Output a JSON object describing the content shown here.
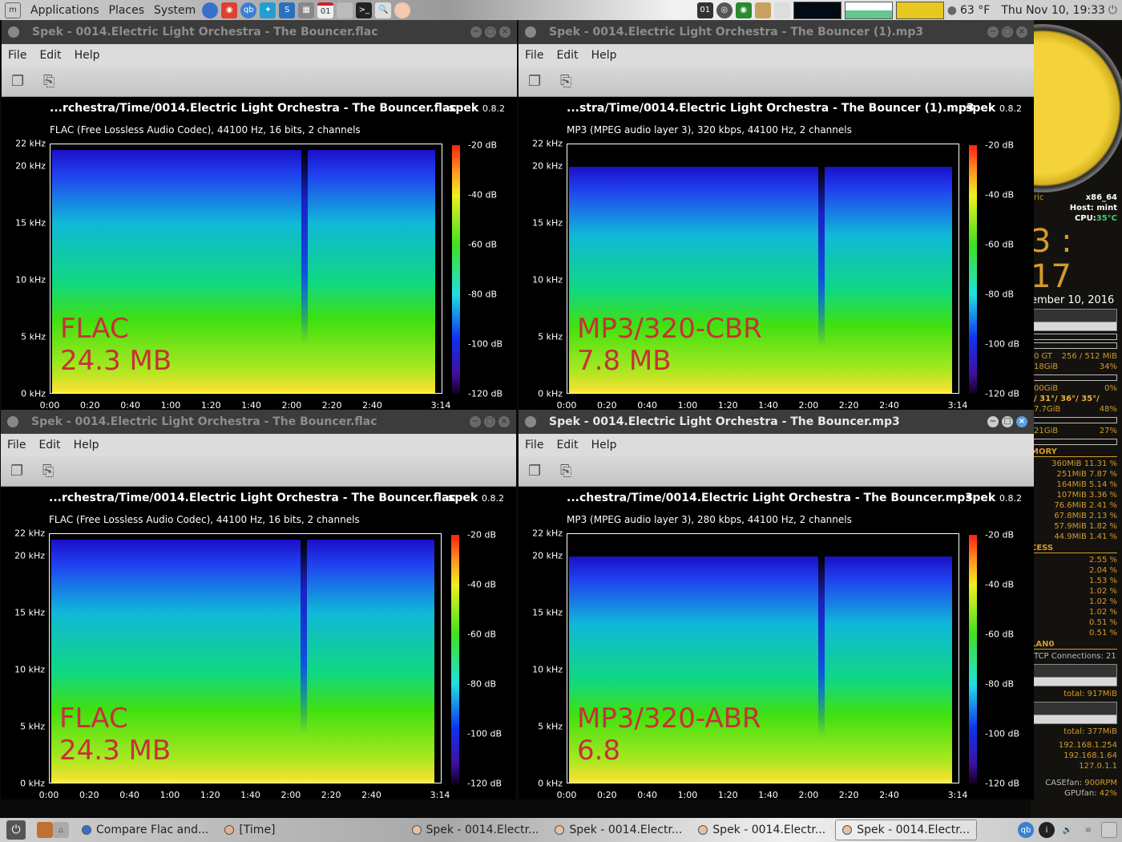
{
  "top_panel": {
    "menu": [
      "Applications",
      "Places",
      "System"
    ],
    "launchers": [
      "globe-icon",
      "chrome-icon",
      "qbittorrent-icon",
      "kodi-icon",
      "steam-icon",
      "calculator-icon",
      "calendar-icon",
      "gimp-icon",
      "terminal-icon",
      "search-icon",
      "pidgin-icon"
    ],
    "calendar_day": "01",
    "weather": "63 °F",
    "datetime": "Thu Nov 10, 19:33"
  },
  "windows": [
    {
      "title": "Spek - 0014.Electric Light Orchestra - The Bouncer.flac",
      "active": false,
      "menu": [
        "File",
        "Edit",
        "Help"
      ],
      "file_path": "...rchestra/Time/0014.Electric Light Orchestra - The Bouncer.flac",
      "app_name": "spek",
      "app_version": "0.8.2",
      "codec_info": "FLAC (Free Lossless Audio Codec), 44100 Hz, 16 bits, 2 channels",
      "overlay_label": [
        "FLAC",
        "24.3 MB"
      ],
      "cutoff_khz": 21.5
    },
    {
      "title": "Spek - 0014.Electric Light Orchestra - The Bouncer (1).mp3",
      "active": false,
      "menu": [
        "File",
        "Edit",
        "Help"
      ],
      "file_path": "...stra/Time/0014.Electric Light Orchestra - The Bouncer (1).mp3",
      "app_name": "spek",
      "app_version": "0.8.2",
      "codec_info": "MP3 (MPEG audio layer 3), 320 kbps, 44100 Hz, 2 channels",
      "overlay_label": [
        "MP3/320-CBR",
        "7.8 MB"
      ],
      "cutoff_khz": 20
    },
    {
      "title": "Spek - 0014.Electric Light Orchestra - The Bouncer.flac",
      "active": false,
      "menu": [
        "File",
        "Edit",
        "Help"
      ],
      "file_path": "...rchestra/Time/0014.Electric Light Orchestra - The Bouncer.flac",
      "app_name": "spek",
      "app_version": "0.8.2",
      "codec_info": "FLAC (Free Lossless Audio Codec), 44100 Hz, 16 bits, 2 channels",
      "overlay_label": [
        "FLAC",
        "24.3 MB"
      ],
      "cutoff_khz": 21.5
    },
    {
      "title": "Spek - 0014.Electric Light Orchestra - The Bouncer.mp3",
      "active": true,
      "menu": [
        "File",
        "Edit",
        "Help"
      ],
      "file_path": "...chestra/Time/0014.Electric Light Orchestra - The Bouncer.mp3",
      "app_name": "spek",
      "app_version": "0.8.2",
      "codec_info": "MP3 (MPEG audio layer 3), 280 kbps, 44100 Hz, 2 channels",
      "overlay_label": [
        "MP3/320-ABR",
        "6.8"
      ],
      "cutoff_khz": 20
    }
  ],
  "spectrogram_axes": {
    "y_ticks": [
      "22 kHz",
      "20 kHz",
      "15 kHz",
      "10 kHz",
      "5 kHz",
      "0 kHz"
    ],
    "y_values_khz": [
      22,
      20,
      15,
      10,
      5,
      0
    ],
    "x_ticks": [
      "0:00",
      "0:20",
      "0:40",
      "1:00",
      "1:20",
      "1:40",
      "2:00",
      "2:20",
      "2:40",
      "3:14"
    ],
    "x_values_s": [
      0,
      20,
      40,
      60,
      80,
      100,
      120,
      140,
      160,
      194
    ],
    "db_ticks": [
      "-20 dB",
      "-40 dB",
      "-60 dB",
      "-80 dB",
      "-100 dB",
      "-120 dB"
    ],
    "db_values": [
      -20,
      -40,
      -60,
      -80,
      -100,
      -120
    ]
  },
  "conky": {
    "arch": "x86_64",
    "host": "Host: mint",
    "cpu_label": "CPU:",
    "cpu_temp": "35°C",
    "time": "3 : 17",
    "date": "ember 10, 2016",
    "gpu": [
      "0 GT",
      "256 / 512 MiB"
    ],
    "disks": [
      [
        "18GiB",
        "34%"
      ],
      [
        "00GiB",
        "0%"
      ],
      [
        "/ 31°/ 36°/ 35°/",
        ""
      ],
      [
        "7.7GiB",
        "48%"
      ],
      [
        "21GiB",
        "27%"
      ]
    ],
    "memory_header": "MORY",
    "memory": [
      [
        "360MiB",
        "11.31 %"
      ],
      [
        "251MiB",
        "7.87 %"
      ],
      [
        "164MiB",
        "5.14 %"
      ],
      [
        "107MiB",
        "3.36 %"
      ],
      [
        "76.6MiB",
        "2.41 %"
      ],
      [
        "67.8MiB",
        "2.13 %"
      ],
      [
        "57.9MiB",
        "1.82 %"
      ],
      [
        "44.9MiB",
        "1.41 %"
      ]
    ],
    "process_header": "CESS",
    "process": [
      "2.55 %",
      "2.04 %",
      "1.53 %",
      "1.02 %",
      "1.02 %",
      "1.02 %",
      "0.51 %",
      "0.51 %"
    ],
    "lan_header": "LAN0",
    "tcp": "TCP Connections: 21",
    "down_total": "total: 917MiB",
    "up_total": "total: 377MiB",
    "ips": [
      "192.168.1.254",
      "192.168.1.64",
      "127.0.1.1"
    ],
    "case_fan": [
      "CASEfan:",
      "900RPM"
    ],
    "gpu_fan": [
      "GPUfan:",
      "42%"
    ]
  },
  "taskbar": {
    "tasks": [
      {
        "label": "Compare Flac and...",
        "icon": "browser-icon",
        "active": false
      },
      {
        "label": "[Time]",
        "icon": "folder-icon",
        "active": false
      },
      {
        "label": "Spek - 0014.Electr...",
        "icon": "spek-icon",
        "active": false
      },
      {
        "label": "Spek - 0014.Electr...",
        "icon": "spek-icon",
        "active": false
      },
      {
        "label": "Spek - 0014.Electr...",
        "icon": "spek-icon",
        "active": false
      },
      {
        "label": "Spek - 0014.Electr...",
        "icon": "spek-icon",
        "active": true
      }
    ]
  }
}
